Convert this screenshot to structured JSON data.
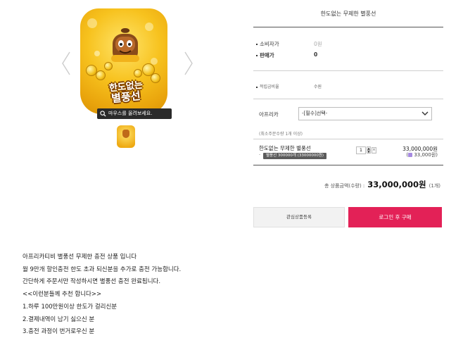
{
  "product": {
    "title": "한도없는 무제한 별풍선",
    "image_title_line1": "한도없는",
    "image_title_line2": "별풍선",
    "hover_hint": "마우스를 올려보세요."
  },
  "pricing": {
    "consumer_price_label": "소비자가",
    "consumer_price": "0원",
    "sale_price_label": "판매가",
    "sale_price": "0",
    "points_label": "적립금비율",
    "points_value": "수원"
  },
  "option": {
    "label": "아프리카",
    "select_value": "-[필수]선택-",
    "note": "(최소주문수량 1개 이상)"
  },
  "selected_item": {
    "name": "한도없는 무제한 별풍선",
    "remove_prefix": "-",
    "option_badge": "별풍선 300000개 (33000000원)",
    "quantity": "1",
    "qty_up": "▲",
    "qty_down": "▼",
    "delete": "×",
    "price": "33,000,000원",
    "points": "33,000원"
  },
  "summary": {
    "label": "총 상품금액(수량) :",
    "amount": "33,000,000원",
    "count": "(1개)"
  },
  "buttons": {
    "wishlist": "관심상품등록",
    "buy": "로그인 후 구매"
  },
  "description": [
    "아프리카티비 별풍선 무제한 충전 상품 입니다",
    "월 9만개 할인충전 한도 초과 되신분을 추가로 충전 가능합니다.",
    "간단하게 주문서만 작성하시면 별풍선 충전 완료됩니다.",
    "<<이런분들께 추천 합니다>>",
    "1.하루 100만원이상 한도가 걸리신분",
    "2.결제내역이 남기 싫으신 분",
    "3.충전 과정이 번거로우신 분"
  ],
  "colors": {
    "buy_button": "#e32157",
    "tile_gold": "#f7c21e"
  },
  "icons": {
    "prev": "chevron-left-icon",
    "next": "chevron-right-icon",
    "zoom": "zoom-icon",
    "dropdown": "chevron-down-icon",
    "points": "points-icon"
  }
}
